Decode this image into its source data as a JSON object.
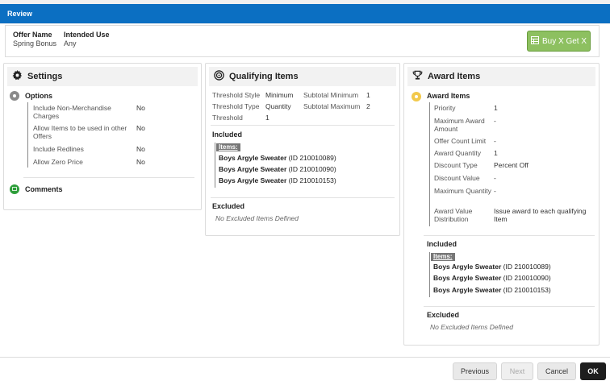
{
  "header": {
    "title": "Review"
  },
  "offer": {
    "name_label": "Offer Name",
    "name_value": "Spring Bonus",
    "use_label": "Intended Use",
    "use_value": "Any",
    "type_button": "Buy X Get X"
  },
  "settings": {
    "title": "Settings",
    "options_title": "Options",
    "rows": [
      {
        "label": "Include Non-Merchandise Charges",
        "value": "No"
      },
      {
        "label": "Allow Items to be used in other Offers",
        "value": "No"
      },
      {
        "label": "Include Redlines",
        "value": "No"
      },
      {
        "label": "Allow Zero Price",
        "value": "No"
      }
    ],
    "comments_title": "Comments"
  },
  "qualifying": {
    "title": "Qualifying Items",
    "threshold_style_label": "Threshold Style",
    "threshold_style_value": "Minimum",
    "subtotal_min_label": "Subtotal Minimum",
    "subtotal_min_value": "1",
    "threshold_type_label": "Threshold Type",
    "threshold_type_value": "Quantity",
    "subtotal_max_label": "Subtotal Maximum",
    "subtotal_max_value": "2",
    "threshold_label": "Threshold",
    "threshold_value": "1",
    "included_title": "Included",
    "items_badge": "Items:",
    "items": [
      {
        "name": "Boys Argyle Sweater",
        "id": "(ID 210010089)"
      },
      {
        "name": "Boys Argyle Sweater",
        "id": "(ID 210010090)"
      },
      {
        "name": "Boys Argyle Sweater",
        "id": "(ID 210010153)"
      }
    ],
    "excluded_title": "Excluded",
    "excluded_none": "No Excluded Items Defined"
  },
  "award": {
    "title": "Award Items",
    "award_items_title": "Award Items",
    "rows": [
      {
        "label": "Priority",
        "value": "1"
      },
      {
        "label": "Maximum Award Amount",
        "value": "-"
      },
      {
        "label": "Offer Count Limit",
        "value": "-"
      },
      {
        "label": "Award Quantity",
        "value": "1"
      },
      {
        "label": "Discount Type",
        "value": "Percent Off"
      },
      {
        "label": "Discount Value",
        "value": "-"
      },
      {
        "label": "Maximum Quantity",
        "value": "-"
      },
      {
        "label": "Award Value Distribution",
        "value": "Issue award to each qualifying Item"
      }
    ],
    "included_title": "Included",
    "items_badge": "Items:",
    "items": [
      {
        "name": "Boys Argyle Sweater",
        "id": "(ID 210010089)"
      },
      {
        "name": "Boys Argyle Sweater",
        "id": "(ID 210010090)"
      },
      {
        "name": "Boys Argyle Sweater",
        "id": "(ID 210010153)"
      }
    ],
    "excluded_title": "Excluded",
    "excluded_none": "No Excluded Items Defined"
  },
  "footer": {
    "previous": "Previous",
    "next": "Next",
    "cancel": "Cancel",
    "ok": "OK"
  }
}
